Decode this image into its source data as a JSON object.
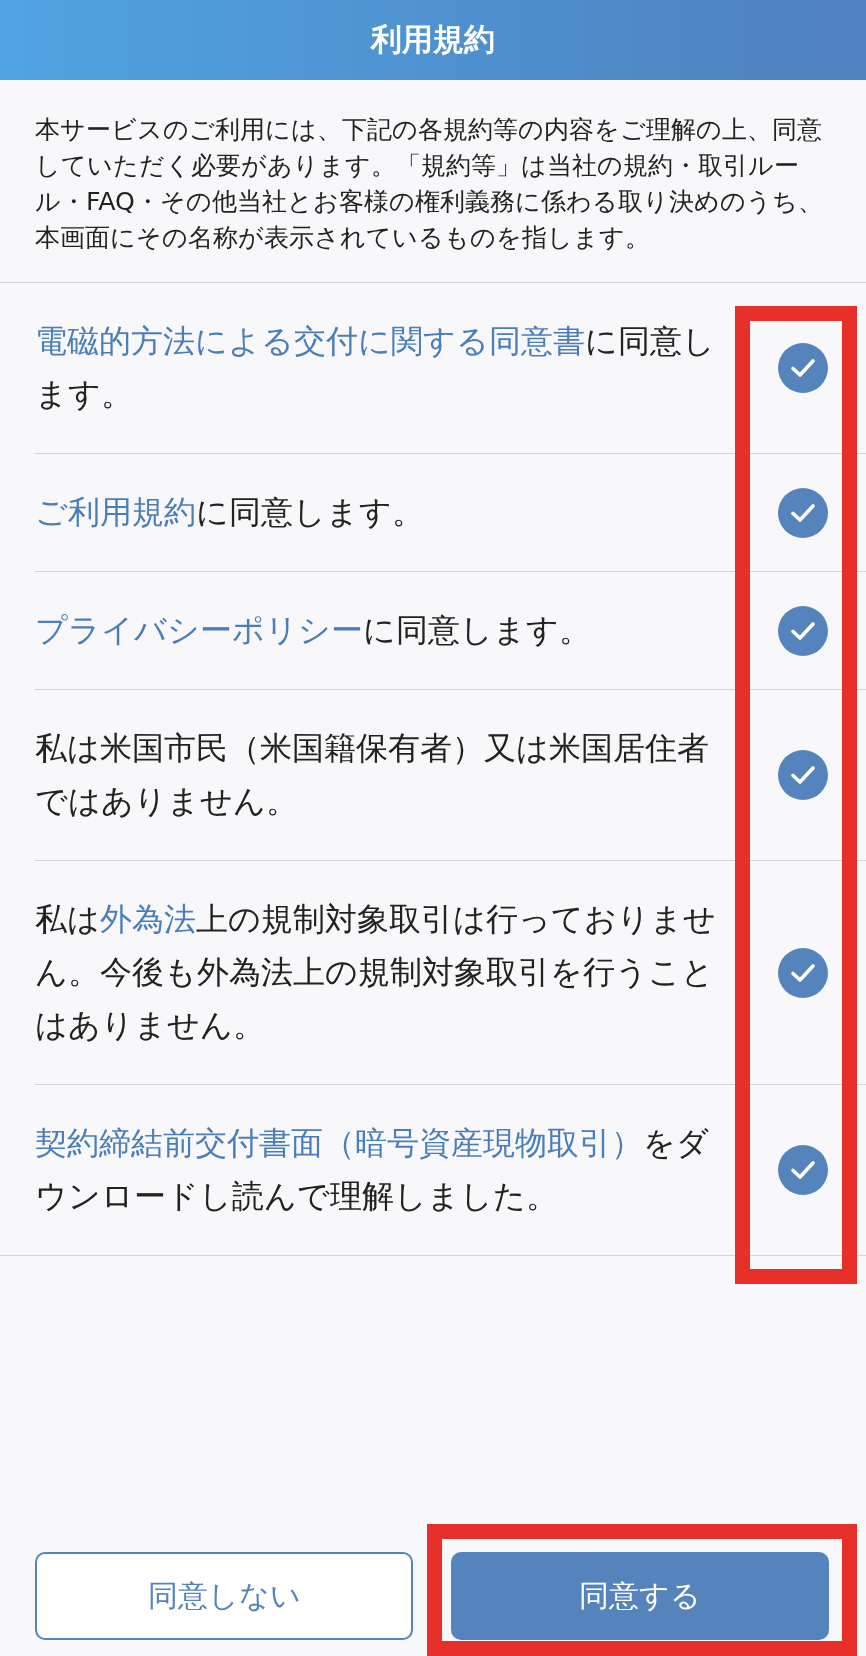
{
  "header": {
    "title": "利用規約"
  },
  "intro": "本サービスのご利用には、下記の各規約等の内容をご理解の上、同意していただく必要があります。「規約等」は当社の規約・取引ルール・FAQ・その他当社とお客様の権利義務に係わる取り決めのうち、本画面にその名称が表示されているものを指します。",
  "agreements": [
    {
      "parts": [
        {
          "text": "電磁的方法による交付に関する同意書",
          "link": true
        },
        {
          "text": "に同意します。",
          "link": false
        }
      ],
      "checked": true
    },
    {
      "parts": [
        {
          "text": "ご利用規約",
          "link": true
        },
        {
          "text": "に同意します。",
          "link": false
        }
      ],
      "checked": true
    },
    {
      "parts": [
        {
          "text": "プライバシーポリシー",
          "link": true
        },
        {
          "text": "に同意します。",
          "link": false
        }
      ],
      "checked": true
    },
    {
      "parts": [
        {
          "text": "私は米国市民（米国籍保有者）又は米国居住者ではありません。",
          "link": false
        }
      ],
      "checked": true
    },
    {
      "parts": [
        {
          "text": "私は",
          "link": false
        },
        {
          "text": "外為法",
          "link": true
        },
        {
          "text": "上の規制対象取引は行っておりません。今後も外為法上の規制対象取引を行うことはありません。",
          "link": false
        }
      ],
      "checked": true
    },
    {
      "parts": [
        {
          "text": "契約締結前交付書面（暗号資産現物取引）",
          "link": true
        },
        {
          "text": "をダウンロードし読んで理解しました。",
          "link": false
        }
      ],
      "checked": true
    }
  ],
  "buttons": [
    {
      "label": "同意しない",
      "kind": "secondary"
    },
    {
      "label": "同意する",
      "kind": "primary"
    }
  ],
  "highlights": {
    "checkboxes": true,
    "agree_button": true
  }
}
